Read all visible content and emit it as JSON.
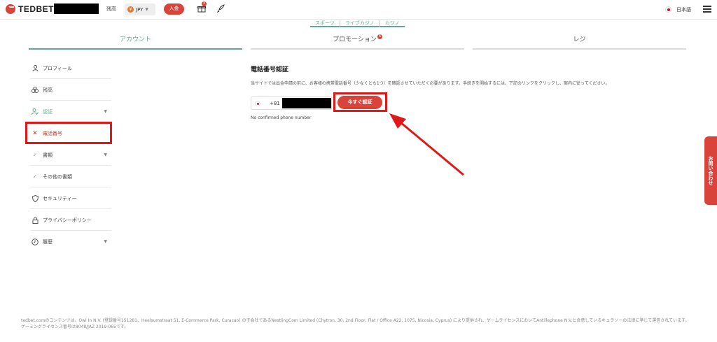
{
  "header": {
    "logo_text": "TEDBET",
    "balance_label": "残高",
    "currency": "JPY",
    "currency_badge": "¥",
    "deposit_label": "入金",
    "gift_badge": "3",
    "language": "日本語"
  },
  "subnav": {
    "items": [
      "スポーツ",
      "ライブカジノ",
      "カジノ"
    ]
  },
  "tabs": {
    "account": "アカウント",
    "promotion": "プロモーション",
    "promotion_badge": "6",
    "cashier": "レジ"
  },
  "sidebar": {
    "items": [
      {
        "label": "プロフィール"
      },
      {
        "label": "残高"
      },
      {
        "label": "認証"
      },
      {
        "label": "電話番号"
      },
      {
        "label": "書類"
      },
      {
        "label": "その他の書類"
      },
      {
        "label": "セキュリティー"
      },
      {
        "label": "プライバシーポリシー"
      },
      {
        "label": "履歴"
      }
    ]
  },
  "content": {
    "title": "電話番号認証",
    "description": "当サイトでは出金申請の前に、お客様の携帯電話番号（少なくとも1つ）を確認させていただく必要があります。手続きを開始するには、下記のリンクをクリックし、案内に従ってください。",
    "phone_code": "+81",
    "verify_button": "今すぐ認証",
    "status": "No confirmed phone number"
  },
  "contact_tab": "お問い合わせ",
  "footer": "tedbet.comのコンテンツは、Owl In N.V. (登録番号151281、Heelsumstraat 51, E-Commerce Park, Curacao) の子会社であるNestlingCom Limited (Chytron, 30, 2nd Floor, Flat / Office A22, 1075, Nicosia, Cyprus) により提供され、ゲームライセンスにおいてAntillephone N.V.と合意しているキュラソーの法律に準じて運営されています。ゲーミングライセンス番号は8048/JAZ 2019-065です。",
  "colors": {
    "accent_green": "#5fa896",
    "brand_red": "#d9433a",
    "annotation_red": "#e01818"
  }
}
